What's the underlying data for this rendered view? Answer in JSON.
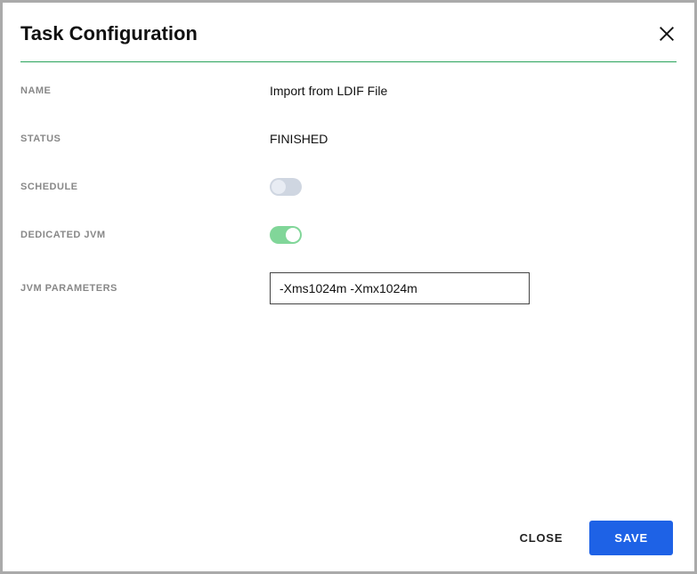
{
  "dialog": {
    "title": "Task Configuration"
  },
  "fields": {
    "name": {
      "label": "NAME",
      "value": "Import from LDIF File"
    },
    "status": {
      "label": "STATUS",
      "value": "FINISHED"
    },
    "schedule": {
      "label": "SCHEDULE",
      "on": false
    },
    "dedicated_jvm": {
      "label": "DEDICATED JVM",
      "on": true
    },
    "jvm_parameters": {
      "label": "JVM PARAMETERS",
      "value": "-Xms1024m -Xmx1024m"
    }
  },
  "footer": {
    "close": "CLOSE",
    "save": "SAVE"
  }
}
